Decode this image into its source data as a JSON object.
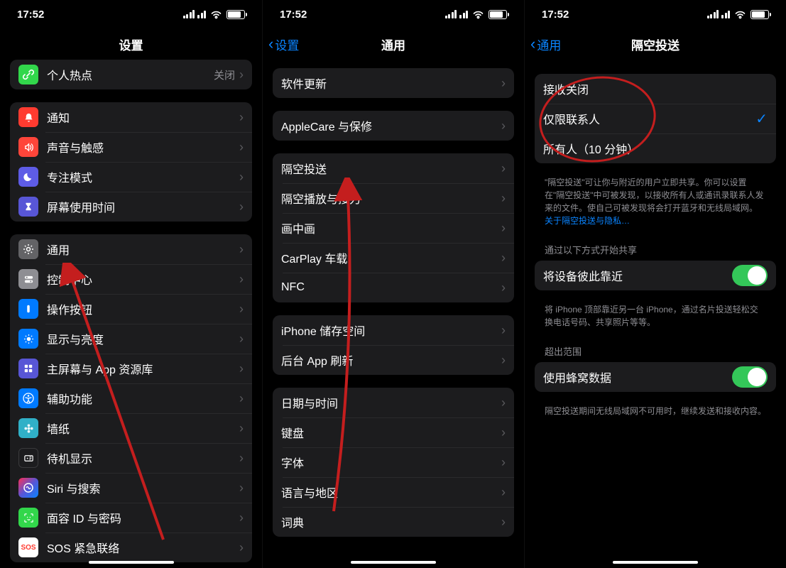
{
  "status": {
    "time": "17:52"
  },
  "phone1": {
    "title": "设置",
    "hotspot": {
      "label": "个人热点",
      "value": "关闭"
    },
    "g1": [
      {
        "label": "通知",
        "icon": "bell",
        "color": "ic-red"
      },
      {
        "label": "声音与触感",
        "icon": "speaker",
        "color": "ic-red2"
      },
      {
        "label": "专注模式",
        "icon": "moon",
        "color": "ic-purple"
      },
      {
        "label": "屏幕使用时间",
        "icon": "hourglass",
        "color": "ic-indigo"
      }
    ],
    "g2": [
      {
        "label": "通用",
        "icon": "gear",
        "color": "ic-gray"
      },
      {
        "label": "控制中心",
        "icon": "switches",
        "color": "ic-gray2"
      },
      {
        "label": "操作按钮",
        "icon": "action",
        "color": "ic-blue"
      },
      {
        "label": "显示与亮度",
        "icon": "sun",
        "color": "ic-blue"
      },
      {
        "label": "主屏幕与 App 资源库",
        "icon": "grid",
        "color": "ic-indigo"
      },
      {
        "label": "辅助功能",
        "icon": "accessibility",
        "color": "ic-blue"
      },
      {
        "label": "墙纸",
        "icon": "flower",
        "color": "ic-teal"
      },
      {
        "label": "待机显示",
        "icon": "standby",
        "color": "ic-black"
      },
      {
        "label": "Siri 与搜索",
        "icon": "siri",
        "color": "ic-multi"
      },
      {
        "label": "面容 ID 与密码",
        "icon": "faceid",
        "color": "ic-green"
      },
      {
        "label": "SOS 紧急联络",
        "icon": "sos",
        "color": "ic-sos"
      }
    ]
  },
  "phone2": {
    "back": "设置",
    "title": "通用",
    "g0": [
      {
        "label": "软件更新"
      }
    ],
    "g1": [
      {
        "label": "AppleCare 与保修"
      }
    ],
    "g2": [
      {
        "label": "隔空投送"
      },
      {
        "label": "隔空播放与接力"
      },
      {
        "label": "画中画"
      },
      {
        "label": "CarPlay 车载"
      },
      {
        "label": "NFC"
      }
    ],
    "g3": [
      {
        "label": "iPhone 储存空间"
      },
      {
        "label": "后台 App 刷新"
      }
    ],
    "g4": [
      {
        "label": "日期与时间"
      },
      {
        "label": "键盘"
      },
      {
        "label": "字体"
      },
      {
        "label": "语言与地区"
      },
      {
        "label": "词典"
      }
    ]
  },
  "phone3": {
    "back": "通用",
    "title": "隔空投送",
    "options": [
      {
        "label": "接收关闭",
        "selected": false
      },
      {
        "label": "仅限联系人",
        "selected": true
      },
      {
        "label": "所有人（10 分钟）",
        "selected": false
      }
    ],
    "desc1": "\"隔空投送\"可让你与附近的用户立即共享。你可以设置在\"隔空投送\"中可被发现，以接收所有人或通讯录联系人发来的文件。使自己可被发现将会打开蓝牙和无线局域网。",
    "desc1_link": "关于隔空投送与隐私…",
    "sec2_header": "通过以下方式开始共享",
    "row2": {
      "label": "将设备彼此靠近"
    },
    "desc2": "将 iPhone 顶部靠近另一台 iPhone，通过名片投送轻松交换电话号码、共享照片等等。",
    "sec3_header": "超出范围",
    "row3": {
      "label": "使用蜂窝数据"
    },
    "desc3": "隔空投送期间无线局域网不可用时，继续发送和接收内容。"
  }
}
